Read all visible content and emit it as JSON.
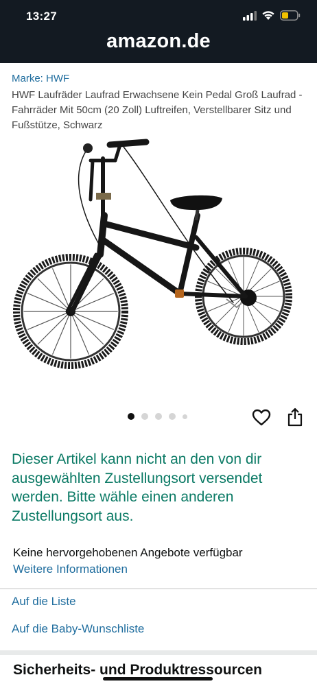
{
  "status_bar": {
    "time": "13:27"
  },
  "header": {
    "domain": "amazon.de"
  },
  "product": {
    "brand": "Marke: HWF",
    "title": "HWF Laufräder Laufrad Erwachsene Kein Pedal Groß Laufrad - Fahrräder Mit 50cm (20 Zoll) Luftreifen, Verstellbarer Sitz und Fußstütze, Schwarz",
    "image_count": 5,
    "active_image": 1
  },
  "notice": {
    "text": "Dieser Artikel kann nicht an den von dir ausgewählten Zustellungsort versendet werden. Bitte wähle einen anderen Zustellungsort aus."
  },
  "offers": {
    "title": "Keine hervorgehobenen Angebote verfügbar",
    "more_info": "Weitere Informationen"
  },
  "actions": {
    "add_to_list": "Auf die Liste",
    "add_to_baby_list": "Auf die Baby-Wunschliste"
  },
  "section": {
    "title": "Sicherheits- und Produktressourcen"
  },
  "icons": {
    "signal": "signal-icon",
    "wifi": "wifi-icon",
    "battery": "battery-icon",
    "heart": "heart-icon",
    "share": "share-icon"
  },
  "colors": {
    "header_bg": "#131a22",
    "link": "#1f6d9e",
    "notice": "#0b7a65",
    "battery_low": "#f2c200"
  }
}
